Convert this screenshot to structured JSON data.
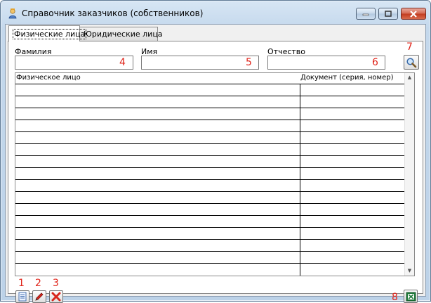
{
  "window": {
    "title": "Справочник заказчиков (собственников)",
    "app_icon": "person-icon"
  },
  "tabs": [
    {
      "label": "Физические лица",
      "active": true
    },
    {
      "label": "Юридические лица",
      "active": false
    }
  ],
  "filters": {
    "last_name_label": "Фамилия",
    "first_name_label": "Имя",
    "middle_name_label": "Отчество",
    "last_name_value": "",
    "first_name_value": "",
    "middle_name_value": ""
  },
  "grid": {
    "columns": [
      "Физическое лицо",
      "Документ (серия, номер)"
    ]
  },
  "annotations": {
    "add": "1",
    "edit": "2",
    "delete": "3",
    "last_name": "4",
    "first_name": "5",
    "middle_name": "6",
    "search": "7",
    "excel": "8"
  },
  "colors": {
    "annotation": "#e0241a"
  }
}
